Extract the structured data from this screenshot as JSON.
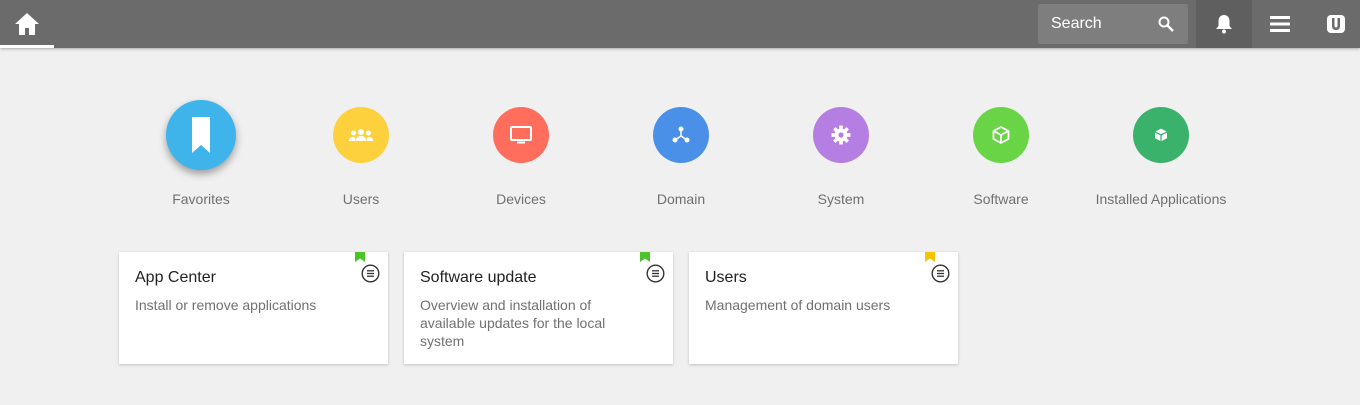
{
  "topbar": {
    "search_placeholder": "Search"
  },
  "icons": {
    "home": "home-icon",
    "search": "search-icon",
    "bell": "bell-icon",
    "menu": "hamburger-menu-icon",
    "logo": "univention-logo-icon"
  },
  "categories": [
    {
      "label": "Favorites",
      "icon": "bookmark-icon",
      "color": "#3fb4ea"
    },
    {
      "label": "Users",
      "icon": "users-group-icon",
      "color": "#fdd13e"
    },
    {
      "label": "Devices",
      "icon": "monitor-icon",
      "color": "#ff6e5c"
    },
    {
      "label": "Domain",
      "icon": "network-nodes-icon",
      "color": "#4a8fe8"
    },
    {
      "label": "System",
      "icon": "gear-icon",
      "color": "#b57ee3"
    },
    {
      "label": "Software",
      "icon": "box-icon",
      "color": "#6ad447"
    },
    {
      "label": "Installed Applications",
      "icon": "box-icon",
      "color": "#3bb26b"
    }
  ],
  "cards": [
    {
      "title": "App Center",
      "description": "Install or remove applications",
      "bookmark_color": "#4cc22b"
    },
    {
      "title": "Software update",
      "description": "Overview and installation of available updates for the local system",
      "bookmark_color": "#4cc22b"
    },
    {
      "title": "Users",
      "description": "Management of domain users",
      "bookmark_color": "#f5c400"
    }
  ]
}
